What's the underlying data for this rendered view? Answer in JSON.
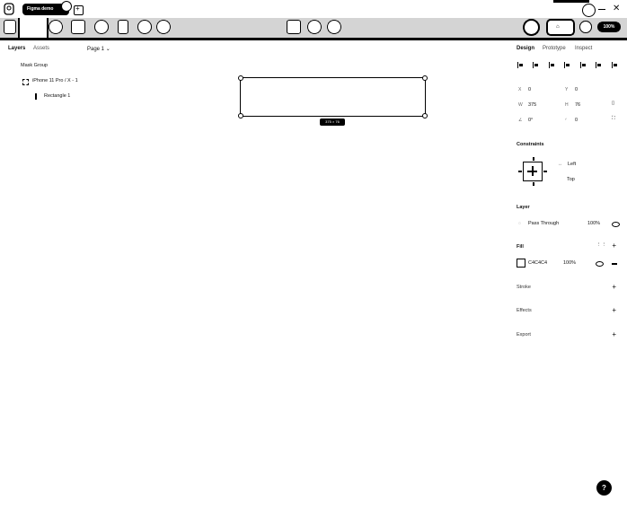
{
  "titlebar": {
    "tab_title": "Figma demo"
  },
  "toolbar": {
    "zoom": "100%",
    "share_label": "Share"
  },
  "left_panel": {
    "layers_tab": "Layers",
    "assets_tab": "Assets",
    "page_select": "Page 1",
    "layers": [
      {
        "name": "Mask Group"
      },
      {
        "name": "iPhone 11 Pro / X - 1"
      },
      {
        "name": "Rectangle 1"
      }
    ]
  },
  "canvas": {
    "selection_size": "375 × 76"
  },
  "right_panel": {
    "tabs": {
      "design": "Design",
      "prototype": "Prototype",
      "inspect": "Inspect"
    },
    "position": {
      "x_label": "X",
      "x_value": "0",
      "y_label": "Y",
      "y_value": "0"
    },
    "size": {
      "w_label": "W",
      "w_value": "375",
      "h_label": "H",
      "h_value": "76"
    },
    "rotation": {
      "r_label": "∠",
      "r_value": "0°",
      "radius_label": "◜",
      "radius_value": "0"
    },
    "constraints": {
      "title": "Constraints",
      "horizontal": "Left",
      "vertical": "Top"
    },
    "layer": {
      "title": "Layer",
      "blend": "Pass Through",
      "opacity": "100%"
    },
    "fill": {
      "title": "Fill",
      "hex": "C4C4C4",
      "opacity": "100%"
    },
    "stroke": {
      "title": "Stroke"
    },
    "effects": {
      "title": "Effects"
    },
    "export": {
      "title": "Export"
    }
  },
  "help": {
    "label": "?"
  }
}
